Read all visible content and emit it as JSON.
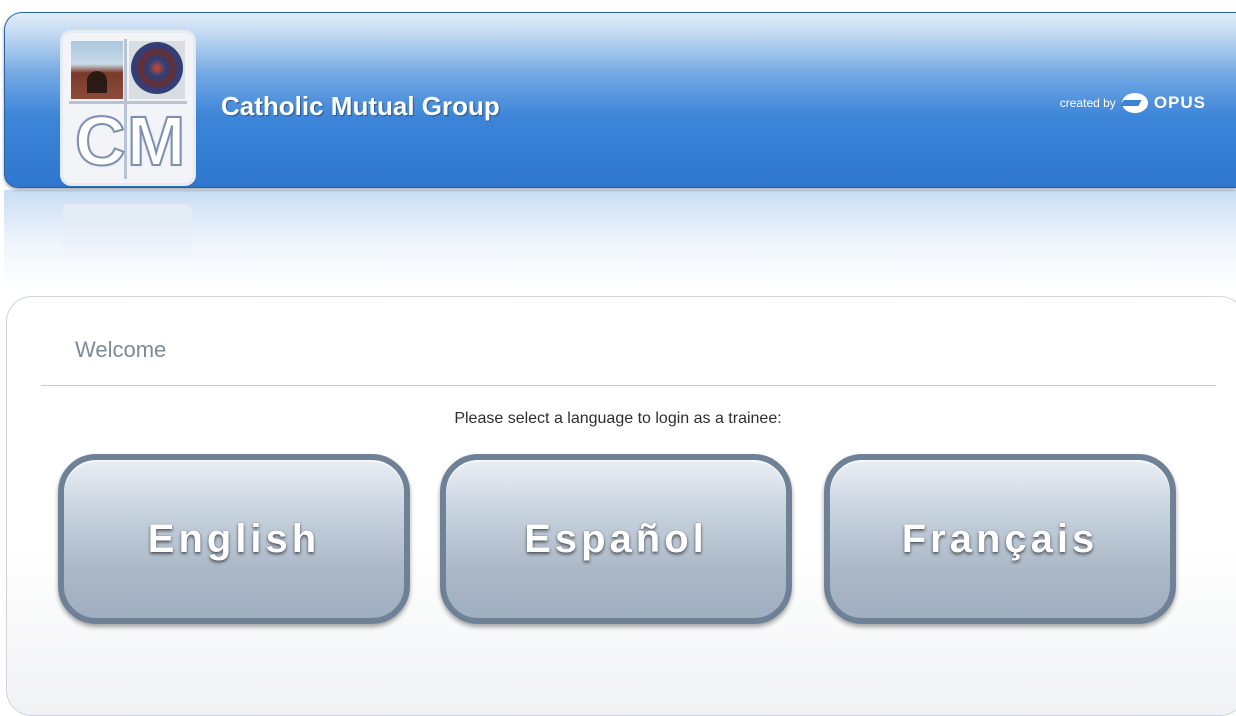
{
  "header": {
    "logo_letters": [
      "C",
      "M"
    ],
    "company_name": "Catholic Mutual Group",
    "credit_prefix": "created by",
    "credit_brand": "OPUS"
  },
  "main": {
    "heading": "Welcome",
    "prompt": "Please select a language to login as a trainee:",
    "languages": [
      {
        "label": "English"
      },
      {
        "label": "Español"
      },
      {
        "label": "Français"
      }
    ]
  },
  "colors": {
    "header_blue": "#3d85d8",
    "button_gray_blue": "#a0afc0",
    "welcome_text": "#7d8a9a"
  }
}
